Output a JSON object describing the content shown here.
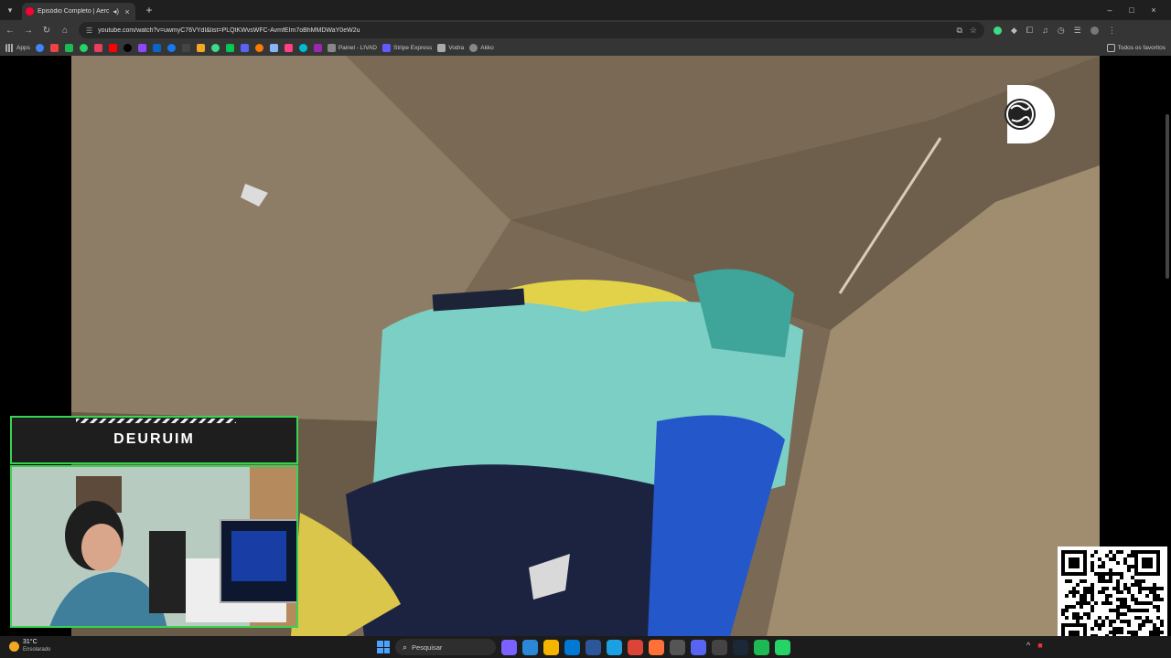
{
  "browser": {
    "tab": {
      "title": "Episódio Completo | Aerop",
      "audio_icon": "speaker-icon",
      "close": "×"
    },
    "new_tab": "+",
    "window_controls": [
      "–",
      "□",
      "×"
    ],
    "url": "youtube.com/watch?v=uwmyC76VYdI&list=PLQtKWvsWFC-AvmfEIm7oBhMMDWaY0eW2u",
    "bookmarks": [
      {
        "label": "Apps",
        "color": "#888888"
      },
      {
        "label": "Painel - LIVAD",
        "color": "#888888"
      },
      {
        "label": "Stripe Express",
        "color": "#635bff"
      },
      {
        "label": "Vodra",
        "color": "#aaaaaa"
      },
      {
        "label": "Akko",
        "color": "#888888"
      }
    ],
    "bookmark_icon_colors": [
      "#4285f4",
      "#e44",
      "#1db954",
      "#25d366",
      "#e4405f",
      "#ff0000",
      "#000000",
      "#9146ff",
      "#0a66c2",
      "#1877f2",
      "#444444",
      "#f5a623",
      "#3ddc84",
      "#00c853",
      "#5865f2",
      "#ff7a00",
      "#8ab4f8",
      "#ff4081",
      "#00bcd4",
      "#9c27b0"
    ],
    "all_bookmarks": "Todos os favoritos"
  },
  "video": {
    "channel_logo": "discovery-globe-logo"
  },
  "webcam": {
    "streamer_name": "DEURUIM"
  },
  "taskbar": {
    "weather": {
      "temp": "31°C",
      "condition": "Ensolarado"
    },
    "search_label": "Pesquisar",
    "apps": [
      {
        "name": "copilot",
        "color": "#7b61ff"
      },
      {
        "name": "store",
        "color": "#2b88d8"
      },
      {
        "name": "explorer",
        "color": "#f4b400"
      },
      {
        "name": "outlook",
        "color": "#0078d4"
      },
      {
        "name": "word",
        "color": "#2b579a"
      },
      {
        "name": "edge",
        "color": "#1ba1e2"
      },
      {
        "name": "chrome",
        "color": "#db4437"
      },
      {
        "name": "firefox",
        "color": "#ff7139"
      },
      {
        "name": "capcut",
        "color": "#555555"
      },
      {
        "name": "discord",
        "color": "#5865f2"
      },
      {
        "name": "obs",
        "color": "#444444"
      },
      {
        "name": "steam",
        "color": "#1b2838"
      },
      {
        "name": "spotify",
        "color": "#1db954"
      },
      {
        "name": "whatsapp",
        "color": "#25d366"
      }
    ],
    "tray": [
      "^",
      "■"
    ]
  }
}
